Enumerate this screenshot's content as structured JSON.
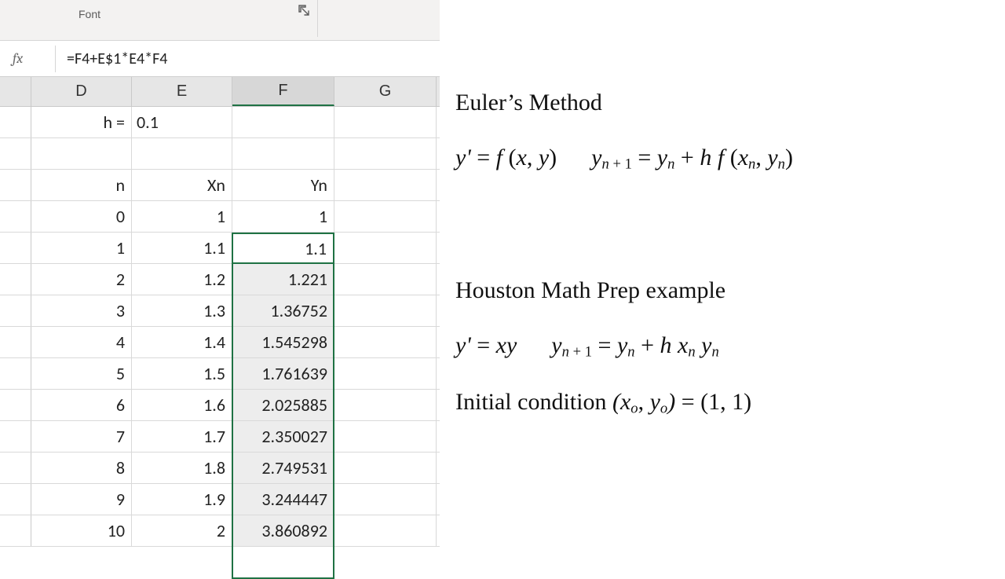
{
  "ribbon": {
    "group_label": "Font"
  },
  "formula_bar": {
    "fx": "fx",
    "formula": "=F4+E$1*E4*F4"
  },
  "columns": [
    "D",
    "E",
    "F",
    "G"
  ],
  "active_column": "F",
  "sheet": {
    "h_label": "h = ",
    "h_value": "0.1",
    "headers": {
      "n": "n",
      "xn": "Xn",
      "yn": "Yn"
    },
    "rows": [
      {
        "n": "0",
        "xn": "1",
        "yn": "1"
      },
      {
        "n": "1",
        "xn": "1.1",
        "yn": "1.1"
      },
      {
        "n": "2",
        "xn": "1.2",
        "yn": "1.221"
      },
      {
        "n": "3",
        "xn": "1.3",
        "yn": "1.36752"
      },
      {
        "n": "4",
        "xn": "1.4",
        "yn": "1.545298"
      },
      {
        "n": "5",
        "xn": "1.5",
        "yn": "1.761639"
      },
      {
        "n": "6",
        "xn": "1.6",
        "yn": "2.025885"
      },
      {
        "n": "7",
        "xn": "1.7",
        "yn": "2.350027"
      },
      {
        "n": "8",
        "xn": "1.8",
        "yn": "2.749531"
      },
      {
        "n": "9",
        "xn": "1.9",
        "yn": "3.244447"
      },
      {
        "n": "10",
        "xn": "2",
        "yn": "3.860892"
      }
    ]
  },
  "notes": {
    "title": "Euler’s Method",
    "ode_general": "y' = f(x, y)",
    "recursion_general_prefix": "y",
    "example_title": "Houston Math Prep example",
    "ode_example": "y' = xy",
    "initial_label": "Initial condition "
  }
}
